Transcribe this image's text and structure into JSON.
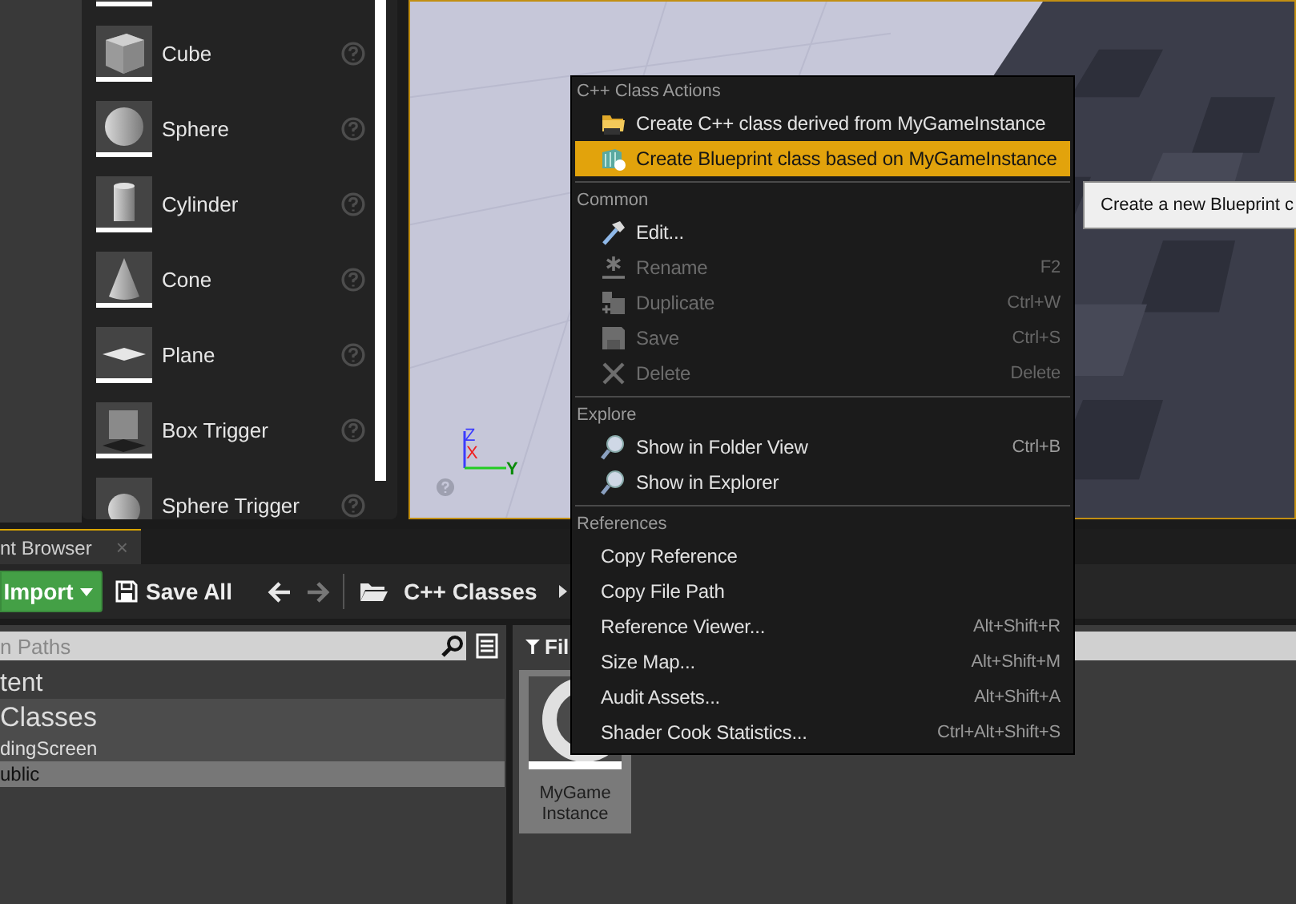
{
  "place_panel": {
    "items": [
      {
        "label": "Cube",
        "kind": "cube"
      },
      {
        "label": "Sphere",
        "kind": "sphere"
      },
      {
        "label": "Cylinder",
        "kind": "cylinder"
      },
      {
        "label": "Cone",
        "kind": "cone"
      },
      {
        "label": "Plane",
        "kind": "plane"
      },
      {
        "label": "Box Trigger",
        "kind": "box-trigger"
      },
      {
        "label": "Sphere Trigger",
        "kind": "sphere-trigger"
      }
    ]
  },
  "viewport": {
    "kind": "picture",
    "gizmo": {
      "z": "Z",
      "x": "X",
      "y": "Y"
    }
  },
  "context_menu": {
    "sections": [
      {
        "header": "C++ Class Actions",
        "items": [
          {
            "label": "Create C++ class derived from MyGameInstance",
            "kind": "cpp",
            "disabled": false,
            "selected": false
          },
          {
            "label": "Create Blueprint class based on MyGameInstance",
            "kind": "blueprint",
            "disabled": false,
            "selected": true
          }
        ]
      },
      {
        "header": "Common",
        "items": [
          {
            "label": "Edit...",
            "kind": "edit",
            "disabled": false,
            "selected": false
          },
          {
            "label": "Rename",
            "kind": "rename",
            "shortcut": "F2",
            "disabled": true,
            "selected": false
          },
          {
            "label": "Duplicate",
            "kind": "duplicate",
            "shortcut": "Ctrl+W",
            "disabled": true,
            "selected": false
          },
          {
            "label": "Save",
            "kind": "save",
            "shortcut": "Ctrl+S",
            "disabled": true,
            "selected": false
          },
          {
            "label": "Delete",
            "kind": "delete",
            "shortcut": "Delete",
            "disabled": true,
            "selected": false
          }
        ]
      },
      {
        "header": "Explore",
        "items": [
          {
            "label": "Show in Folder View",
            "kind": "find",
            "shortcut": "Ctrl+B",
            "disabled": false,
            "selected": false
          },
          {
            "label": "Show in Explorer",
            "kind": "find",
            "disabled": false,
            "selected": false
          }
        ]
      },
      {
        "header": "References",
        "items": [
          {
            "label": "Copy Reference",
            "kind": "plain",
            "disabled": false,
            "selected": false
          },
          {
            "label": "Copy File Path",
            "kind": "plain",
            "disabled": false,
            "selected": false
          },
          {
            "label": "Reference Viewer...",
            "kind": "plain",
            "shortcut": "Alt+Shift+R",
            "disabled": false,
            "selected": false
          },
          {
            "label": "Size Map...",
            "kind": "plain",
            "shortcut": "Alt+Shift+M",
            "disabled": false,
            "selected": false
          },
          {
            "label": "Audit Assets...",
            "kind": "plain",
            "shortcut": "Alt+Shift+A",
            "disabled": false,
            "selected": false
          },
          {
            "label": "Shader Cook Statistics...",
            "kind": "plain",
            "shortcut": "Ctrl+Alt+Shift+S",
            "disabled": false,
            "selected": false
          }
        ]
      }
    ]
  },
  "tooltip": {
    "text": "Create a new Blueprint c"
  },
  "content_browser": {
    "tab": {
      "label": "nt Browser",
      "close": "×"
    },
    "toolbar": {
      "import_button": "Import",
      "save_all_button": "Save All",
      "back_enabled": true,
      "forward_enabled": false,
      "breadcrumb": "C++ Classes"
    },
    "paths": {
      "search": {
        "placeholder": "n Paths"
      },
      "tree": [
        {
          "label": "tent",
          "selected": false,
          "highlighted": false,
          "children": [
            {
              "label": "Classes",
              "selected": false,
              "highlighted": true,
              "children": [
                {
                  "label": "dingScreen",
                  "selected": false,
                  "highlighted": true,
                  "children": [
                    {
                      "label": "ublic",
                      "selected": true,
                      "highlighted": false
                    }
                  ]
                }
              ]
            }
          ]
        }
      ]
    },
    "assets": {
      "filter": "Fil",
      "items": [
        {
          "label": "MyGame Instance",
          "selected": true
        }
      ]
    }
  }
}
